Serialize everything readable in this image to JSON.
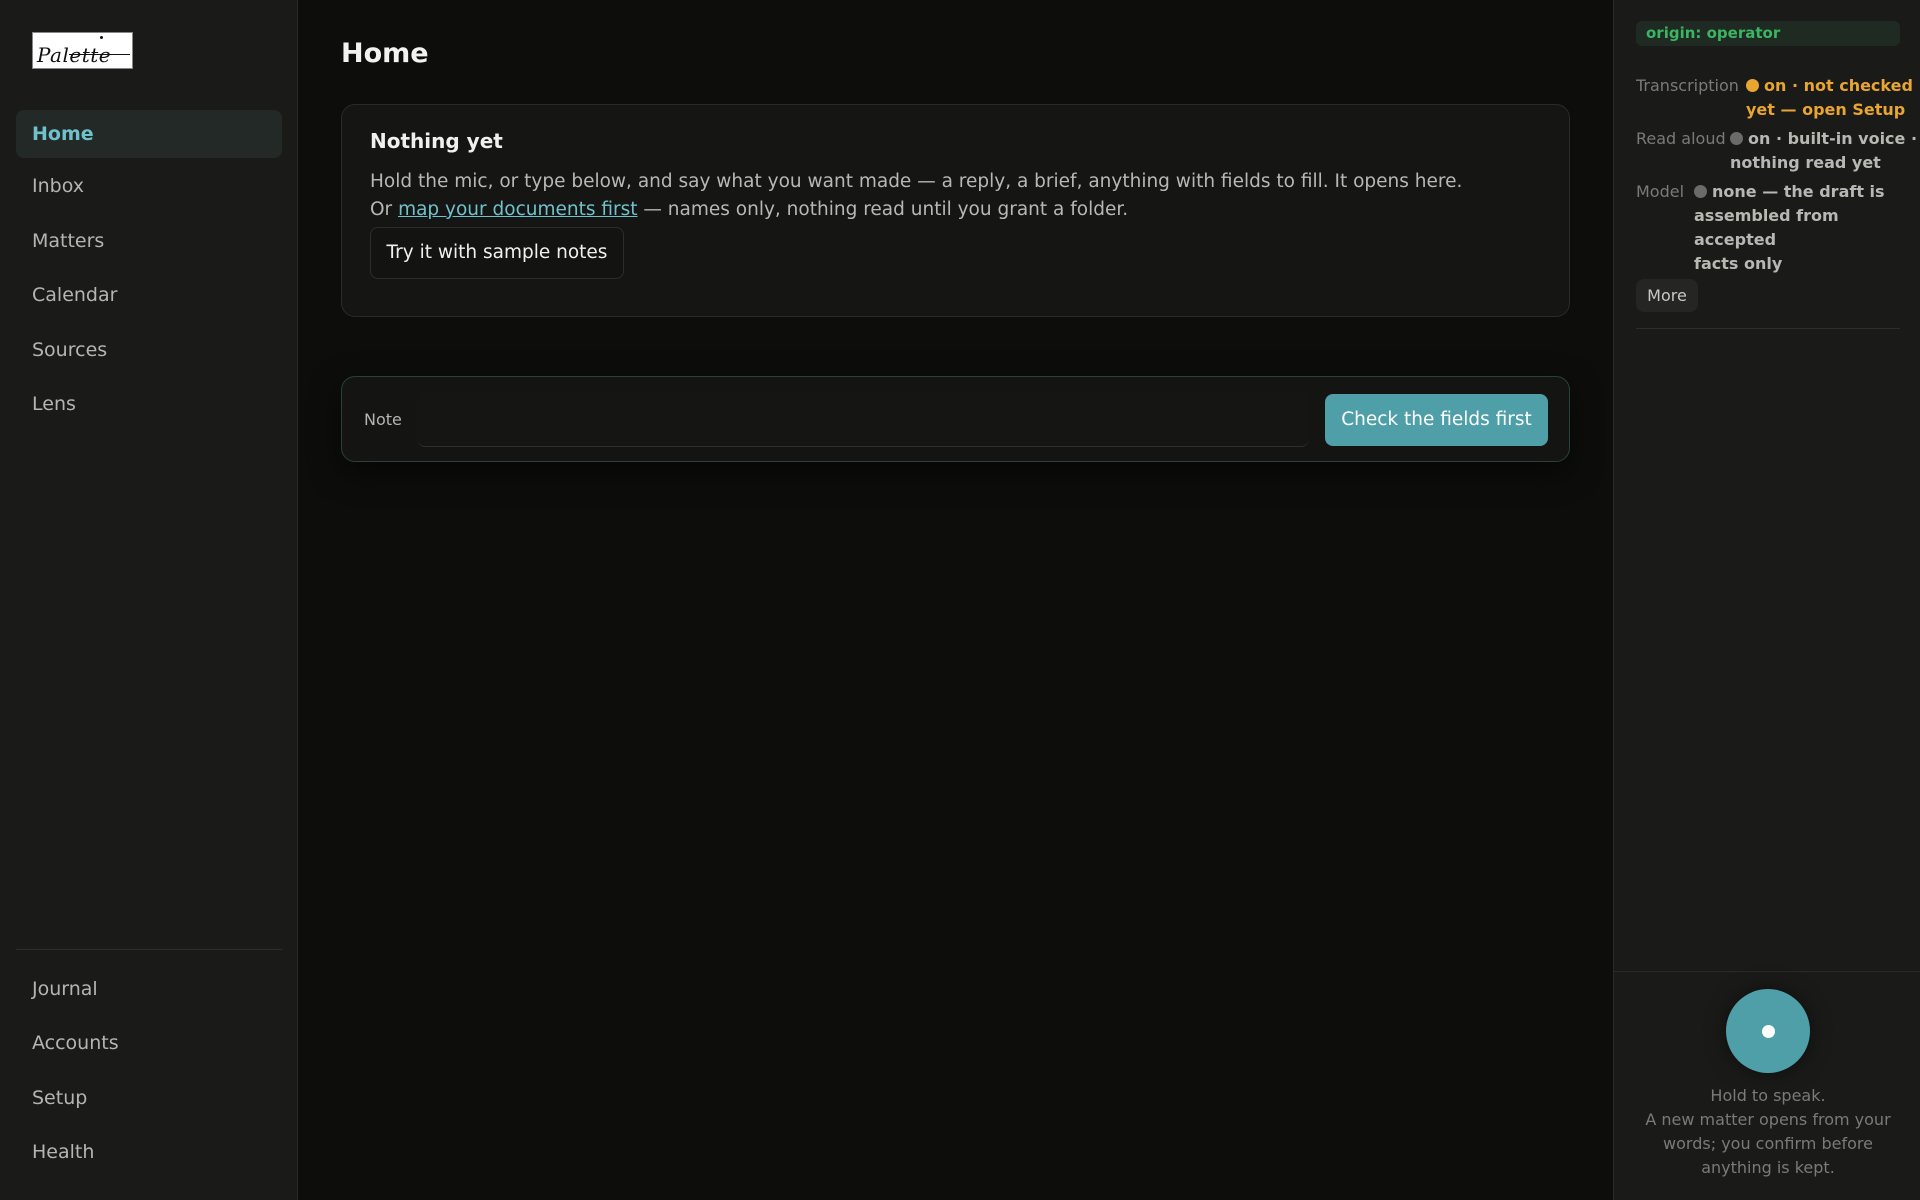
{
  "logo": {
    "text": "Palette"
  },
  "sidebar": {
    "items": [
      {
        "label": "Home",
        "active": true
      },
      {
        "label": "Inbox"
      },
      {
        "label": "Matters"
      },
      {
        "label": "Calendar"
      },
      {
        "label": "Sources"
      },
      {
        "label": "Lens"
      }
    ],
    "bottom_items": [
      {
        "label": "Journal"
      },
      {
        "label": "Accounts"
      },
      {
        "label": "Setup"
      },
      {
        "label": "Health"
      }
    ]
  },
  "main": {
    "title": "Home",
    "card": {
      "title": "Nothing yet",
      "line1": "Hold the mic, or type below, and say what you want made — a reply, a brief, anything with fields to fill. It opens here.",
      "line2_prefix": "Or ",
      "line2_link": "map your documents first",
      "line2_suffix": " — names only, nothing read until you grant a folder.",
      "sample_button": "Try it with sample notes"
    },
    "composer": {
      "note_label": "Note",
      "note_value": "",
      "note_placeholder": "",
      "check_button": "Check the fields first"
    }
  },
  "right_panel": {
    "origin_badge": "origin: operator",
    "status": {
      "transcription": {
        "label": "Transcription",
        "line1": "on · not checked",
        "line2": "yet — open Setup",
        "color": "#e8a531"
      },
      "read_aloud": {
        "label": "Read aloud",
        "line1": "on · built-in voice ·",
        "line2": "nothing read yet"
      },
      "model": {
        "label": "Model",
        "line1": "none — the draft is",
        "line2": "assembled from accepted",
        "line3": "facts only"
      }
    },
    "more_button": "More",
    "hold_title": "Hold to speak.",
    "hold_desc1": "A new matter opens from your",
    "hold_desc2": "words; you confirm before",
    "hold_desc3": "anything is kept."
  },
  "colors": {
    "accent": "#4e9fa8",
    "link": "#6fc2cc",
    "warning": "#e8a531",
    "success": "#3cb563"
  }
}
